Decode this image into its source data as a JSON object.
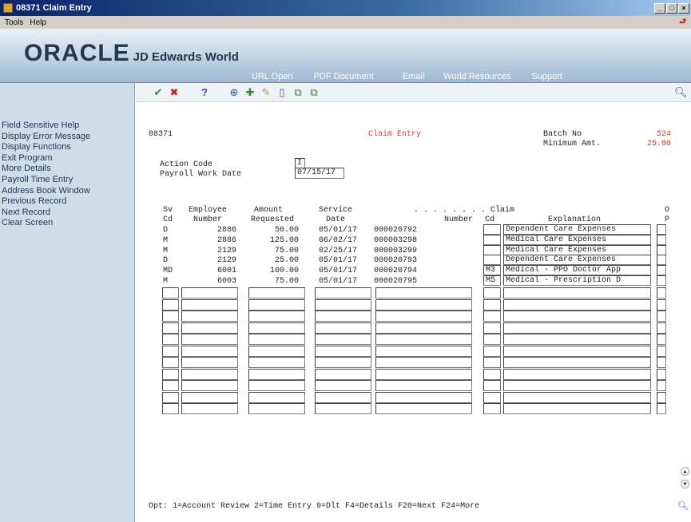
{
  "window": {
    "title": "08371   Claim Entry",
    "buttons": [
      "_",
      "□",
      "×"
    ]
  },
  "menu": {
    "tools": "Tools",
    "help": "Help"
  },
  "banner": {
    "oracle": "ORACLE",
    "product": "JD Edwards World",
    "links": [
      "URL Open",
      "PDF Document",
      "Email",
      "World Resources",
      "Support"
    ]
  },
  "sidebar": {
    "items": [
      "Field Sensitive Help",
      "Display Error Message",
      "Display Functions",
      "Exit Program",
      "More Details",
      "Payroll Time Entry",
      "Address Book Window",
      "Previous Record",
      "Next Record",
      "Clear Screen"
    ]
  },
  "toolbar": {
    "icons": [
      "ok-check-icon",
      "cancel-x-icon",
      "help-question-icon",
      "search-binoculars-icon",
      "add-plus-icon",
      "edit-pencil-icon",
      "delete-trash-icon",
      "copy-icon",
      "paste-icon",
      "magnify-icon"
    ]
  },
  "form": {
    "program": "08371",
    "title": "Claim Entry",
    "batch_label": "Batch No",
    "batch_value": "524",
    "min_amt_label": "Minimum Amt.",
    "min_amt_value": "25.00",
    "action_code_label": "Action Code",
    "action_code_value": "I",
    "payroll_date_label": "Payroll Work Date",
    "payroll_date_value": "07/15/17"
  },
  "grid": {
    "header1": {
      "sv": "Sv",
      "employee": "Employee",
      "amount": "Amount",
      "service": "Service",
      "dots": ". . . . . . . . Claim",
      "o": "O"
    },
    "header2": {
      "cd": "Cd",
      "number": "Number",
      "requested": "Requested",
      "date": "Date",
      "claim_number": "Number",
      "claim_cd": "Cd",
      "explanation": "Explanation",
      "p": "P"
    },
    "rows": [
      {
        "sv": "D",
        "emp": "2886",
        "amt": "50.00",
        "date": "05/01/17",
        "claim": "000020792",
        "cd": "",
        "expl": "Dependent Care Expenses"
      },
      {
        "sv": "M",
        "emp": "2886",
        "amt": "125.00",
        "date": "06/02/17",
        "claim": "000003298",
        "cd": "",
        "expl": "Medical Care Expenses"
      },
      {
        "sv": "M",
        "emp": "2129",
        "amt": "75.00",
        "date": "02/25/17",
        "claim": "000003299",
        "cd": "",
        "expl": "Medical Care Expenses"
      },
      {
        "sv": "D",
        "emp": "2129",
        "amt": "25.00",
        "date": "05/01/17",
        "claim": "000020793",
        "cd": "",
        "expl": "Dependent Care Expenses"
      },
      {
        "sv": "MD",
        "emp": "6001",
        "amt": "100.00",
        "date": "05/01/17",
        "claim": "000020794",
        "cd": "M3",
        "expl": "Medical - PPO Doctor App"
      },
      {
        "sv": "M",
        "emp": "6003",
        "amt": "75.00",
        "date": "05/01/17",
        "claim": "000020795",
        "cd": "M5",
        "expl": "Medical - Prescription D"
      }
    ],
    "empty_rows": 11
  },
  "footer": {
    "options": "Opt:  1=Account Review  2=Time Entry  9=Dlt  F4=Details  F20=Next  F24=More"
  }
}
